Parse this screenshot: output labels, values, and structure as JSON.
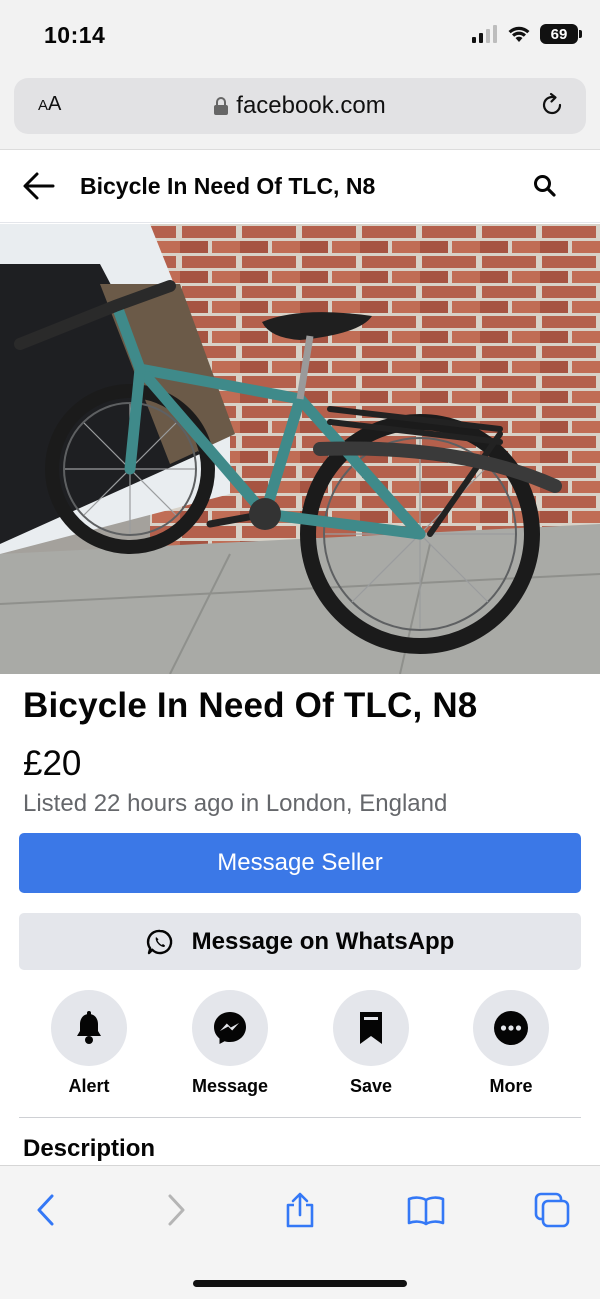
{
  "status_bar": {
    "time": "10:14",
    "battery": "69"
  },
  "browser": {
    "text_size_label_small": "A",
    "text_size_label_large": "A",
    "url": "facebook.com"
  },
  "header": {
    "title": "Bicycle In Need Of TLC, N8"
  },
  "listing": {
    "title": "Bicycle In Need Of TLC, N8",
    "price": "£20",
    "listed": "Listed 22 hours ago in London, England"
  },
  "buttons": {
    "message_seller": "Message Seller",
    "message_whatsapp": "Message on WhatsApp"
  },
  "actions": [
    {
      "label": "Alert",
      "icon": "bell-icon"
    },
    {
      "label": "Message",
      "icon": "messenger-icon"
    },
    {
      "label": "Save",
      "icon": "bookmark-icon"
    },
    {
      "label": "More",
      "icon": "more-icon"
    }
  ],
  "description_heading": "Description",
  "colors": {
    "primary_button": "#3b78e7",
    "safari_blue": "#3478f6"
  }
}
